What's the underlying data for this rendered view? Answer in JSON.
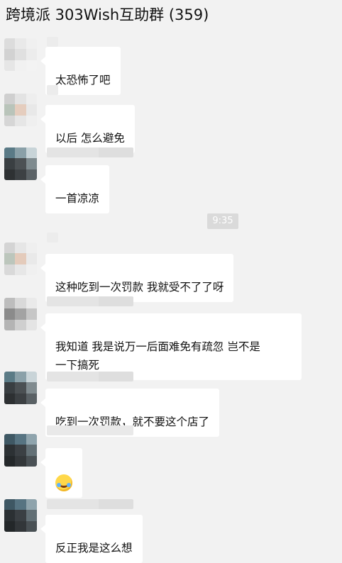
{
  "window": {
    "title": "跨境派 303Wish互助群 (359)"
  },
  "timestamp": "9:35",
  "messages": [
    {
      "text": "太恐怖了吧"
    },
    {
      "text": "以后 怎么避免"
    },
    {
      "text": "一首凉凉"
    },
    {
      "text": "这种吃到一次罚款 我就受不了了呀"
    },
    {
      "text": "我知道 我是说万一后面难免有疏忽 岂不是\n一下搞死"
    },
    {
      "text": "吃到一次罚款，就不要这个店了"
    },
    {
      "emoji": "laughing-crying-emoji"
    },
    {
      "text": "反正我是这么想"
    }
  ],
  "avatar_palettes": [
    [
      "#dcdcdc",
      "#e9e9e9",
      "#f0f0f0",
      "#d2d2d2",
      "#e0e0e0",
      "#ececec",
      "#e6e6e6",
      "#f1f1f1",
      "#f3f3f3"
    ],
    [
      "#cfcfcf",
      "#e3e3e3",
      "#eeeeee",
      "#b9c4ba",
      "#e5cdbe",
      "#e8e8e8",
      "#d6d6d6",
      "#e6e6e6",
      "#efefef"
    ],
    [
      "#5a7a86",
      "#8aa0a8",
      "#c8d4d8",
      "#3a3f42",
      "#4c5154",
      "#7f8b8f",
      "#2e3133",
      "#3d4144",
      "#5b6266"
    ],
    [
      "#d4d4d4",
      "#e6e6e6",
      "#efefef",
      "#bcc6bc",
      "#e4cbbb",
      "#e9e9e9",
      "#d9d9d9",
      "#e7e7e7",
      "#f0f0f0"
    ],
    [
      "#bdbdbd",
      "#d9d9d9",
      "#eaeaea",
      "#8b8b8b",
      "#a3a3a3",
      "#c6c6c6",
      "#b4b4b4",
      "#cfcfcf",
      "#e4e4e4"
    ],
    [
      "#5b7b86",
      "#8ba1a9",
      "#c9d4d8",
      "#393e41",
      "#4b5053",
      "#808b8f",
      "#2d3032",
      "#3c4043",
      "#5a6165"
    ],
    [
      "#3f5864",
      "#577482",
      "#8fa4ad",
      "#2c3134",
      "#3b4044",
      "#637076",
      "#24282a",
      "#33373a",
      "#4a5155"
    ],
    [
      "#3e5763",
      "#567381",
      "#8ea3ac",
      "#2b3033",
      "#3a3f43",
      "#626f75",
      "#232729",
      "#323639",
      "#495054"
    ]
  ]
}
